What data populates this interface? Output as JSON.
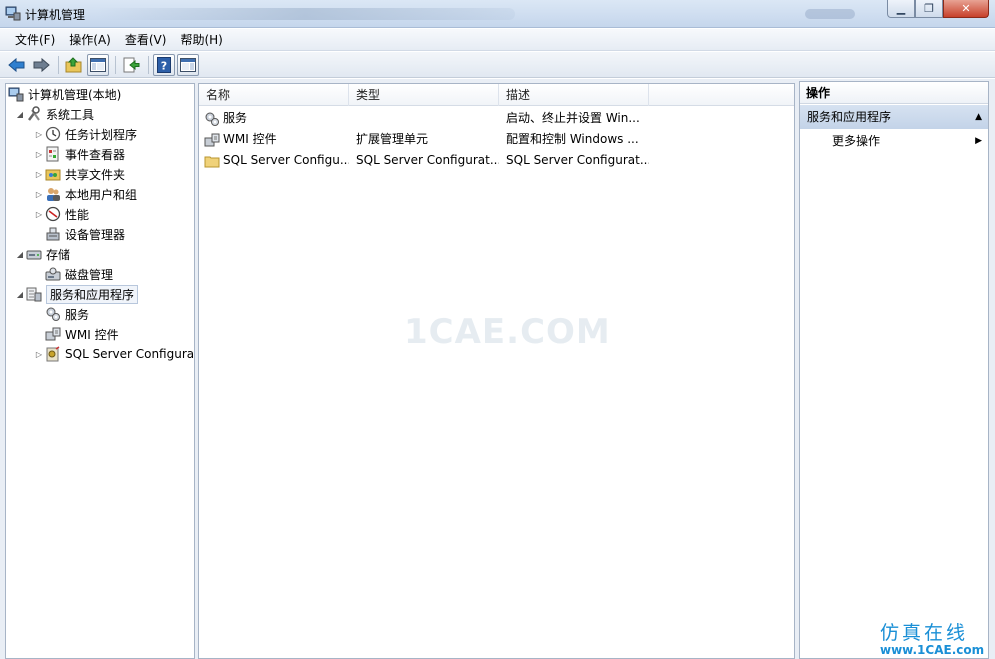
{
  "window": {
    "title": "计算机管理"
  },
  "menu": [
    "文件(F)",
    "操作(A)",
    "查看(V)",
    "帮助(H)"
  ],
  "toolbar": [
    "back-icon",
    "forward-icon",
    "up-folder-icon",
    "show-tree-icon",
    "export-icon",
    "help-icon",
    "show-action-pane-icon"
  ],
  "tree": {
    "root": "计算机管理(本地)",
    "system_tools": "系统工具",
    "task_scheduler": "任务计划程序",
    "event_viewer": "事件查看器",
    "shared_folders": "共享文件夹",
    "local_users": "本地用户和组",
    "performance": "性能",
    "device_manager": "设备管理器",
    "storage": "存储",
    "disk_management": "磁盘管理",
    "services_apps": "服务和应用程序",
    "services": "服务",
    "wmi": "WMI 控件",
    "sql": "SQL Server Configura"
  },
  "list": {
    "columns": [
      "名称",
      "类型",
      "描述"
    ],
    "rows": [
      {
        "name": "服务",
        "type": "",
        "desc": "启动、终止并设置 Win..."
      },
      {
        "name": "WMI 控件",
        "type": "扩展管理单元",
        "desc": "配置和控制 Windows ..."
      },
      {
        "name": "SQL Server Configu...",
        "type": "SQL Server Configurat...",
        "desc": "SQL Server Configurat..."
      }
    ]
  },
  "watermark": "1CAE.COM",
  "actions": {
    "title": "操作",
    "section": "服务和应用程序",
    "more": "更多操作"
  },
  "brand": {
    "cn": "仿真在线",
    "url": "www.1CAE.com"
  },
  "colors": {
    "accent": "#1a8fd6",
    "section_bg": "#c3d3e8",
    "title_bg": "#c5d6ec"
  }
}
